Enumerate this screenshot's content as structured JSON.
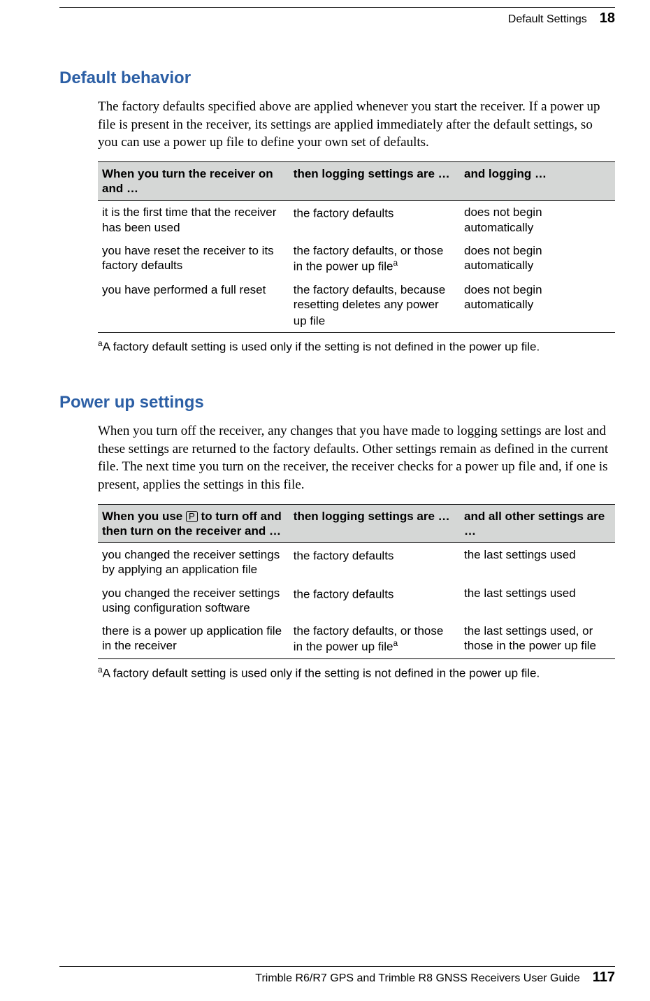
{
  "header": {
    "section": "Default Settings",
    "chapter": "18"
  },
  "sections": {
    "s1": {
      "heading": "Default behavior",
      "body": "The factory defaults specified above are applied whenever you start the receiver. If a power up file is present in the receiver, its settings are applied immediately after the default settings, so you can use a power up file to define your own set of defaults.",
      "table": {
        "headers": {
          "h1": "When you turn the receiver on and …",
          "h2": "then logging settings are …",
          "h3": "and logging …"
        },
        "rows": [
          {
            "c1": "it is the first time that the receiver has been used",
            "c2": "the factory defaults",
            "c3": "does not begin automatically",
            "sup2": ""
          },
          {
            "c1": "you have reset the receiver to its factory defaults",
            "c2": "the factory defaults, or those in the power up file",
            "c3": "does not begin automatically",
            "sup2": "a"
          },
          {
            "c1": "you have performed a full reset",
            "c2": "the factory defaults, because resetting deletes any power up file",
            "c3": "does not begin automatically",
            "sup2": ""
          }
        ]
      },
      "footnote": "A factory default setting is used only if the setting is not defined in the power up file."
    },
    "s2": {
      "heading": "Power up settings",
      "body": "When you turn off the receiver, any changes that you have made to logging settings are lost and these settings are returned to the factory defaults. Other settings remain as defined in the current file. The next time you turn on the receiver, the receiver checks for a power up file and, if one is present, applies the settings in this file.",
      "table": {
        "headers": {
          "h1a": "When you use ",
          "h1b": " to turn off and then turn on the receiver and …",
          "pbox": "P",
          "h2": "then logging settings are …",
          "h3": "and all other settings are …"
        },
        "rows": [
          {
            "c1": "you changed the receiver settings by applying an application file",
            "c2": "the factory defaults",
            "c3": "the last settings used",
            "sup2": ""
          },
          {
            "c1": "you changed the receiver settings using configuration software",
            "c2": "the factory defaults",
            "c3": "the last settings used",
            "sup2": ""
          },
          {
            "c1": "there is a power up application file in the receiver",
            "c2": "the factory defaults, or those in the power up file",
            "c3": "the last settings used, or those in the power up file",
            "sup2": "a"
          }
        ]
      },
      "footnote": "A factory default setting is used only if the setting is not defined in the power up file."
    }
  },
  "footer": {
    "title": "Trimble R6/R7 GPS and Trimble R8 GNSS Receivers User Guide",
    "page": "117"
  },
  "footnote_marker": "a"
}
